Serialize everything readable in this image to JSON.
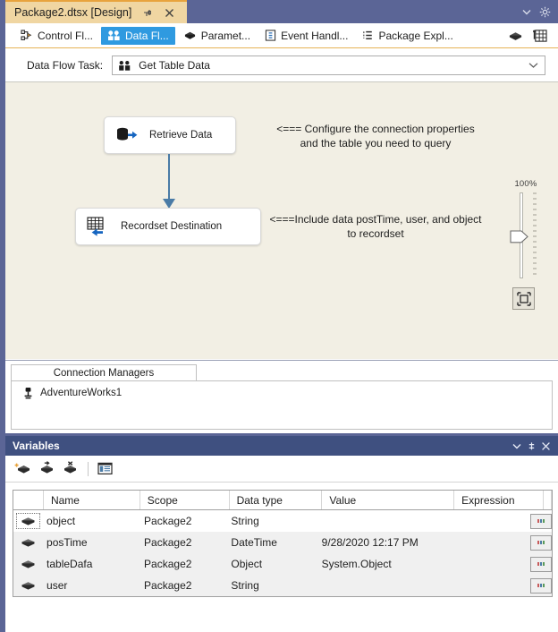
{
  "window": {
    "document_tab": "Package2.dtsx [Design]",
    "pin_icon": "pin-icon",
    "close_icon": "close-icon",
    "dropdown_icon": "chevron-down-icon",
    "settings_icon": "gear-icon"
  },
  "designer_tabs": [
    {
      "label": "Control Fl...",
      "icon": "control-flow-icon",
      "active": false
    },
    {
      "label": "Data Fl...",
      "icon": "data-flow-icon",
      "active": true
    },
    {
      "label": "Paramet...",
      "icon": "parameters-icon",
      "active": false
    },
    {
      "label": "Event Handl...",
      "icon": "event-handlers-icon",
      "active": false
    },
    {
      "label": "Package Expl...",
      "icon": "package-explorer-icon",
      "active": false
    }
  ],
  "designer_tools_right": [
    {
      "icon": "parameters-icon",
      "name": "parameters-button"
    },
    {
      "icon": "grid-properties-icon",
      "name": "grid-properties-button"
    }
  ],
  "task_selector": {
    "label": "Data Flow Task:",
    "value": "Get Table Data",
    "icon": "data-flow-task-icon",
    "caret": "chevron-down-icon"
  },
  "canvas": {
    "components": [
      {
        "name": "retrieve-data",
        "label": "Retrieve Data",
        "icon": "ole-db-source-icon"
      },
      {
        "name": "recordset-destination",
        "label": "Recordset Destination",
        "icon": "recordset-destination-icon"
      }
    ],
    "annotations": [
      {
        "name": "annotation-configure-connection",
        "text": "<=== Configure the connection properties\nand the table you need to query"
      },
      {
        "name": "annotation-include-data",
        "text": "<===Include data postTime, user, and object\nto recordset"
      }
    ],
    "zoom": {
      "percent": "100%",
      "fit_icon": "zoom-to-fit-icon"
    }
  },
  "connection_managers": {
    "tab_label": "Connection Managers",
    "items": [
      {
        "name": "AdventureWorks1",
        "icon": "connection-manager-icon"
      }
    ]
  },
  "variables_window": {
    "title": "Variables",
    "dropdown_icon": "chevron-down-icon",
    "pin_icon": "pin-icon",
    "close_icon": "close-icon",
    "toolbar": [
      {
        "name": "add-variable-button",
        "icon": "add-variable-icon"
      },
      {
        "name": "move-variable-button",
        "icon": "move-variable-icon"
      },
      {
        "name": "delete-variable-button",
        "icon": "delete-variable-icon"
      },
      {
        "name": "grid-options-button",
        "icon": "grid-options-icon"
      }
    ],
    "columns": [
      "Name",
      "Scope",
      "Data type",
      "Value",
      "Expression"
    ],
    "rows": [
      {
        "icon": "variable-icon",
        "name": "object",
        "scope": "Package2",
        "type": "String",
        "value": "",
        "expression": "",
        "button": "ellipsis-button"
      },
      {
        "icon": "variable-icon",
        "name": "posTime",
        "scope": "Package2",
        "type": "DateTime",
        "value": "9/28/2020 12:17 PM",
        "expression": "",
        "button": "ellipsis-button"
      },
      {
        "icon": "variable-icon",
        "name": "tableDafa",
        "scope": "Package2",
        "type": "Object",
        "value": "System.Object",
        "expression": "",
        "button": "ellipsis-button"
      },
      {
        "icon": "variable-icon",
        "name": "user",
        "scope": "Package2",
        "type": "String",
        "value": "",
        "expression": "",
        "button": "ellipsis-button"
      }
    ]
  },
  "colors": {
    "chrome": "#5b6596",
    "tab_active": "#f0d6a2",
    "tab_accent": "#e8a33d",
    "selected_tab": "#2f9ae0",
    "panel_title": "#3f5080",
    "canvas": "#f2efe4",
    "arrow": "#4a7ba6"
  }
}
